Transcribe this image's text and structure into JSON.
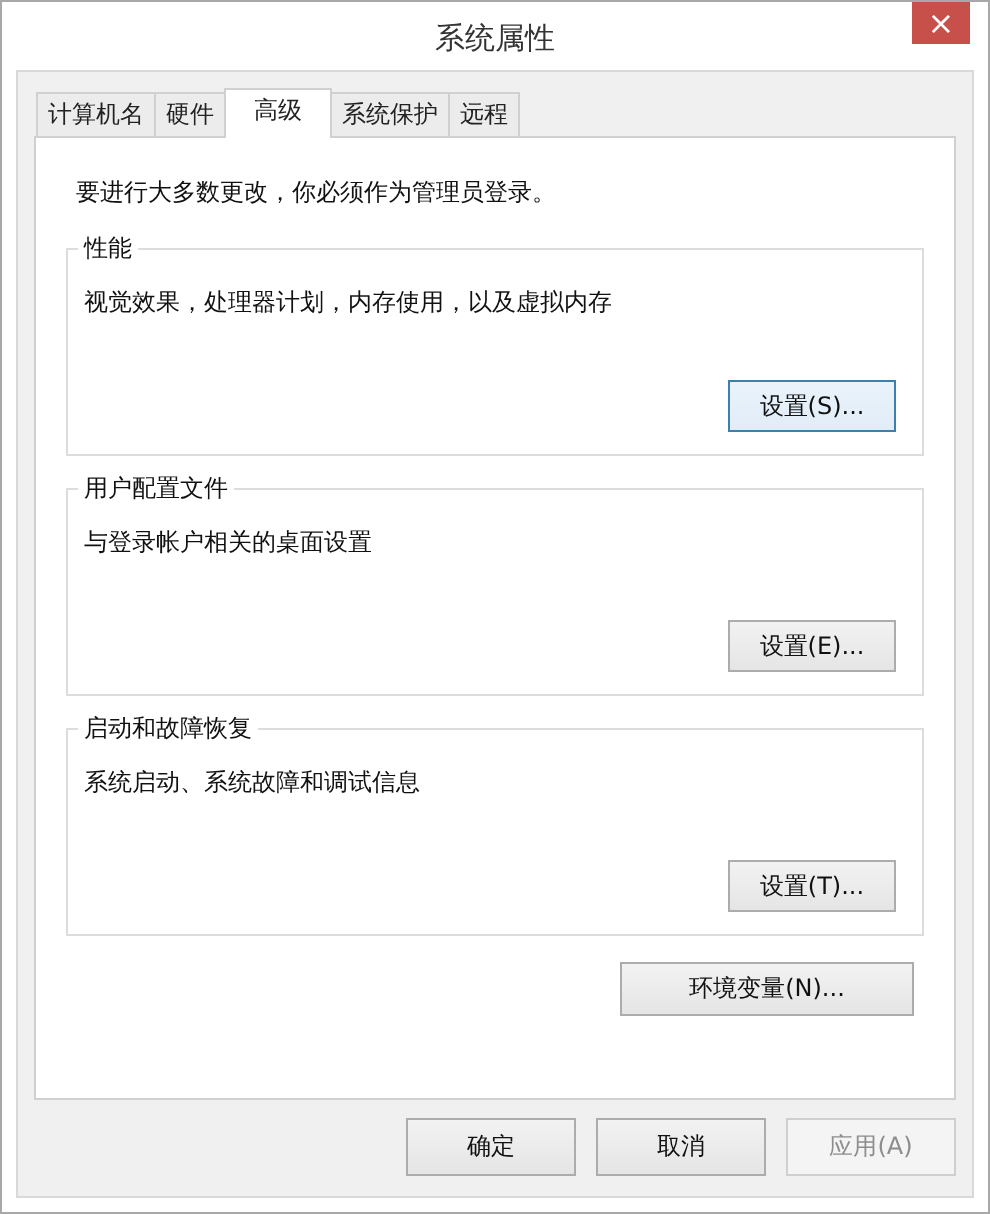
{
  "window": {
    "title": "系统属性",
    "close": "×"
  },
  "tabs": [
    {
      "label": "计算机名",
      "selected": false
    },
    {
      "label": "硬件",
      "selected": false
    },
    {
      "label": "高级",
      "selected": true
    },
    {
      "label": "系统保护",
      "selected": false
    },
    {
      "label": "远程",
      "selected": false
    }
  ],
  "notice": "要进行大多数更改，你必须作为管理员登录。",
  "groups": [
    {
      "title": "性能",
      "description": "视觉效果，处理器计划，内存使用，以及虚拟内存",
      "button": {
        "label": "设置(S)...",
        "focused": true
      }
    },
    {
      "title": "用户配置文件",
      "description": "与登录帐户相关的桌面设置",
      "button": {
        "label": "设置(E)...",
        "focused": false
      }
    },
    {
      "title": "启动和故障恢复",
      "description": "系统启动、系统故障和调试信息",
      "button": {
        "label": "设置(T)...",
        "focused": false
      }
    }
  ],
  "env_button": "环境变量(N)...",
  "footer_buttons": [
    {
      "label": "确定",
      "disabled": false
    },
    {
      "label": "取消",
      "disabled": false
    },
    {
      "label": "应用(A)",
      "disabled": true
    }
  ]
}
